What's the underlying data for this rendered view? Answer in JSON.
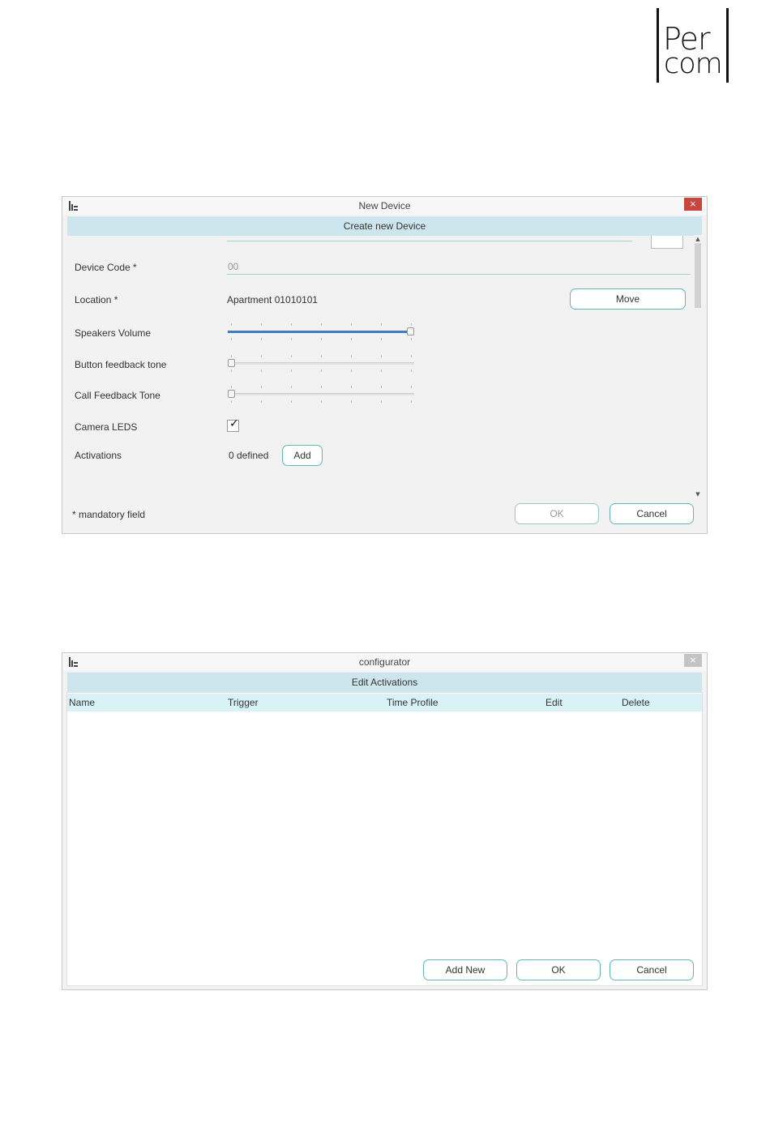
{
  "logo": {
    "line1": "Per",
    "line2": "com"
  },
  "new_device_window": {
    "title": "New Device",
    "close": "×",
    "header": "Create new Device",
    "fields": {
      "device_code_label": "Device Code *",
      "device_code_value": "00",
      "location_label": "Location *",
      "location_value": "Apartment 01010101",
      "move_button": "Move",
      "speakers_volume_label": "Speakers Volume",
      "speakers_volume_level": 1.0,
      "button_feedback_label": "Button feedback tone",
      "button_feedback_level": 0.0,
      "call_feedback_label": "Call Feedback Tone",
      "call_feedback_level": 0.0,
      "camera_leds_label": "Camera LEDS",
      "camera_leds_checked": true,
      "camera_leds_check": "✓",
      "activations_label": "Activations",
      "activations_value": "0 defined",
      "add_button": "Add"
    },
    "footer": {
      "mandatory_note": "* mandatory field",
      "ok_button": "OK",
      "cancel_button": "Cancel"
    },
    "scroll_up": "▲",
    "scroll_down": "▼"
  },
  "configurator_window": {
    "title": "configurator",
    "close": "×",
    "header": "Edit Activations",
    "columns": [
      "Name",
      "Trigger",
      "Time Profile",
      "Edit",
      "Delete"
    ],
    "rows": [],
    "add_new_button": "Add New",
    "ok_button": "OK",
    "cancel_button": "Cancel"
  },
  "colors": {
    "header_bg": "#cde6ee",
    "table_head_bg": "#d9f2f6",
    "button_border": "#5fb7b7",
    "slider_fill": "#3b7cc4",
    "close_red": "#c9463d"
  }
}
